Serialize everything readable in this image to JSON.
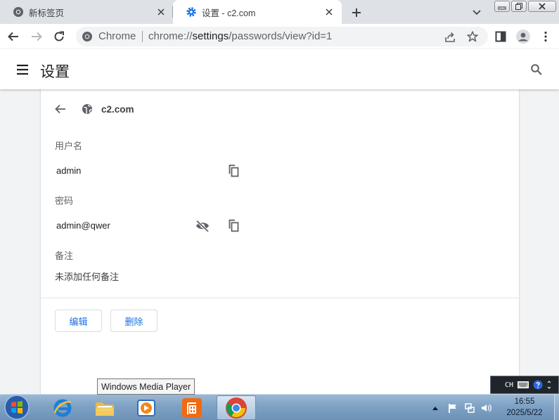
{
  "browser": {
    "tabs": [
      {
        "title": "新标签页",
        "favicon": "chrome-icon",
        "active": false
      },
      {
        "title": "设置 - c2.com",
        "favicon": "settings-gear-icon",
        "active": true
      }
    ],
    "omnibox": {
      "scheme_label": "Chrome",
      "url_prefix": "chrome://",
      "url_host": "settings",
      "url_path": "/passwords/view?id=1"
    }
  },
  "settings": {
    "page_title": "设置",
    "site": "c2.com",
    "username_label": "用户名",
    "username": "admin",
    "password_label": "密码",
    "password": "admin@qwer",
    "note_label": "备注",
    "note": "未添加任何备注",
    "edit_button": "编辑",
    "delete_button": "删除"
  },
  "taskbar": {
    "tooltip": "Windows Media Player",
    "language_indicator": "CH",
    "time": "16:55",
    "date": "2025/5/22"
  },
  "colors": {
    "accent": "#1a73e8",
    "tab_strip": "#dee1e6",
    "taskbar": "#7fa2c4"
  }
}
